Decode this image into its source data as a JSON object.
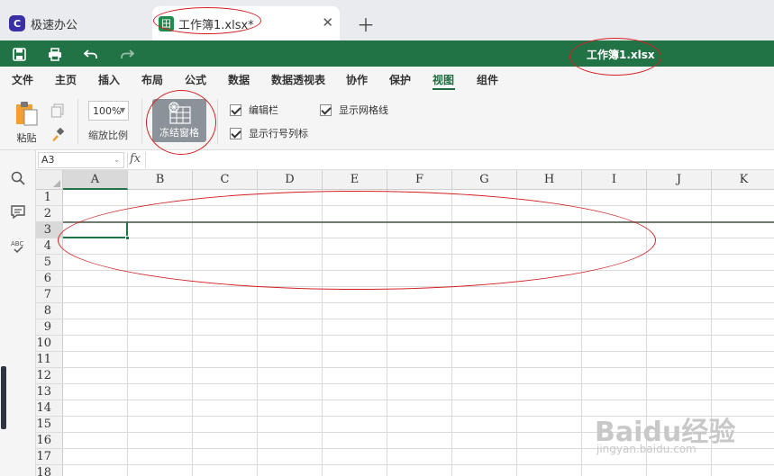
{
  "tabs": [
    {
      "label": "极速办公",
      "icon": "C"
    },
    {
      "label": "工作簿1.xlsx*",
      "icon": "田"
    }
  ],
  "window": {
    "title": "工作簿1.xlsx"
  },
  "menu": [
    "文件",
    "主页",
    "插入",
    "布局",
    "公式",
    "数据",
    "数据透视表",
    "协作",
    "保护",
    "视图",
    "组件"
  ],
  "active_menu": "视图",
  "ribbon": {
    "paste_label": "粘贴",
    "zoom_value": "100%",
    "zoom_label": "缩放比例",
    "freeze_label": "冻结窗格",
    "checks": {
      "formula_bar": "编辑栏",
      "gridlines": "显示网格线",
      "headings": "显示行号列标"
    }
  },
  "formula": {
    "namebox": "A3",
    "fx": "fx"
  },
  "grid": {
    "columns": [
      "A",
      "B",
      "C",
      "D",
      "E",
      "F",
      "G",
      "H",
      "I",
      "J",
      "K"
    ],
    "rows": [
      "1",
      "2",
      "3",
      "4",
      "5",
      "6",
      "7",
      "8",
      "9",
      "10",
      "11",
      "12",
      "13",
      "14",
      "15",
      "16",
      "17",
      "18"
    ],
    "selected_col": "A",
    "selected_row": "3"
  },
  "watermark": {
    "text": "Baidu经验",
    "url": "jingyan.baidu.com"
  },
  "colors": {
    "green": "#217346",
    "annotation": "#d42020"
  }
}
